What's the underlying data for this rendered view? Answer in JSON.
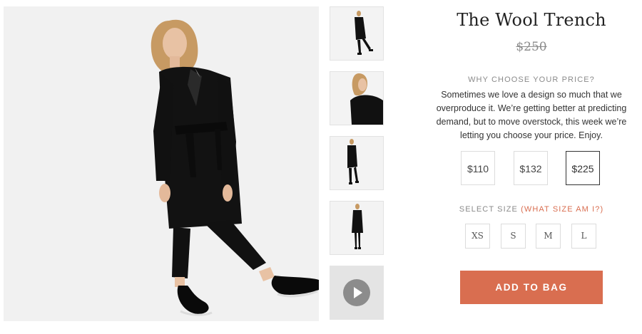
{
  "product": {
    "title": "The Wool Trench",
    "original_price": "$250",
    "coat_color": "#111111"
  },
  "gallery": {
    "main_image": "model-front-walking",
    "thumbnails": [
      {
        "image": "model-full-side",
        "icon": ""
      },
      {
        "image": "model-closeup-side",
        "icon": ""
      },
      {
        "image": "model-full-front",
        "icon": ""
      },
      {
        "image": "model-full-back",
        "icon": ""
      },
      {
        "image": "video",
        "icon": "play-icon"
      }
    ]
  },
  "pricing": {
    "heading": "WHY CHOOSE YOUR PRICE?",
    "description": "Sometimes we love a design so much that we overproduce it. We’re getting better at predicting demand, but to move overstock, this week we’re letting you choose your price. Enjoy.",
    "options": [
      "$110",
      "$132",
      "$225"
    ],
    "selected": "$225"
  },
  "size": {
    "label": "SELECT SIZE",
    "help_link": "(WHAT SIZE AM I?)",
    "options": [
      "XS",
      "S",
      "M",
      "L"
    ]
  },
  "cta": {
    "label": "ADD TO BAG",
    "color": "#d96e50"
  }
}
